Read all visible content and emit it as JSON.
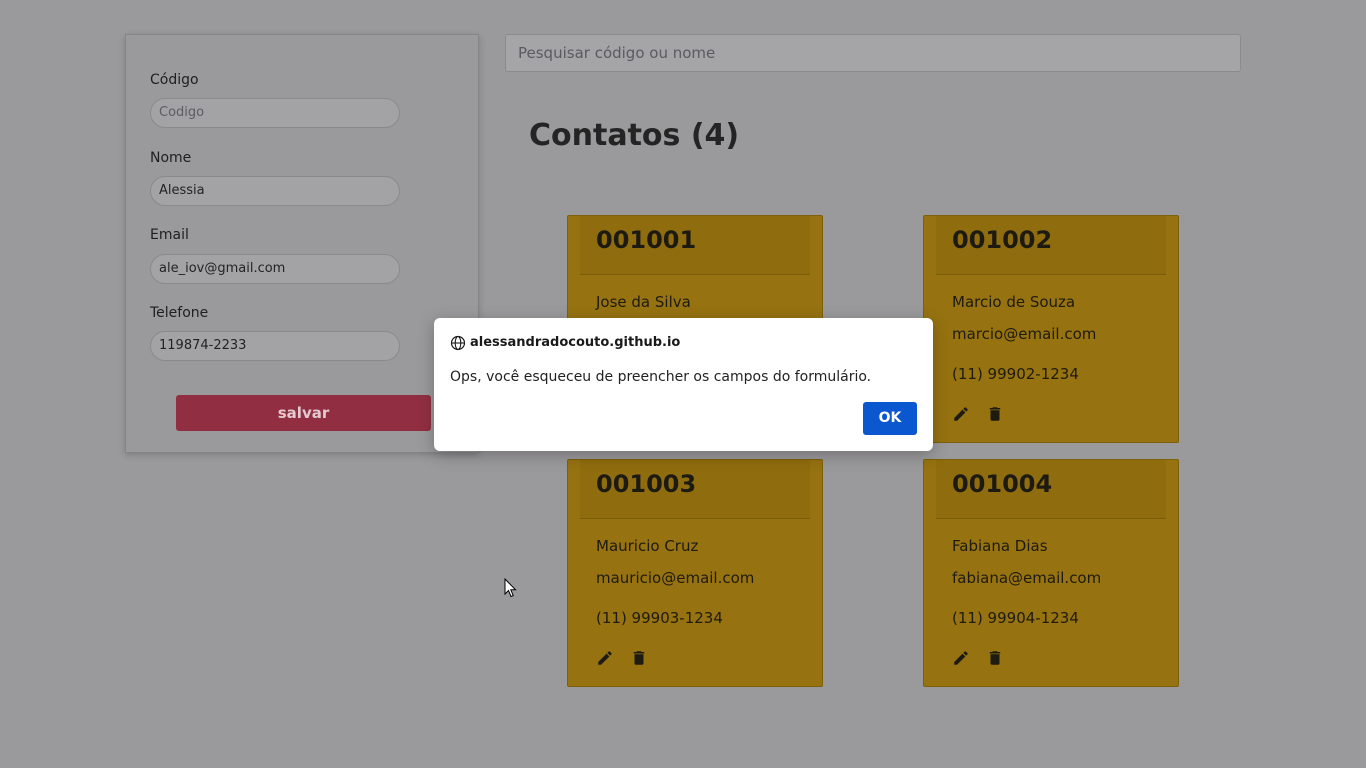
{
  "form": {
    "codigo_label": "Código",
    "codigo_placeholder": "Codigo",
    "nome_label": "Nome",
    "nome_value": "Alessia",
    "email_label": "Email",
    "email_value": "ale_iov@gmail.com",
    "telefone_label": "Telefone",
    "telefone_value": "119874-2233",
    "save_label": "salvar"
  },
  "search": {
    "placeholder": "Pesquisar código ou nome"
  },
  "contacts": {
    "title": "Contatos (4)",
    "cards": [
      {
        "code": "001001",
        "name": "Jose da Silva",
        "email": "",
        "phone": ""
      },
      {
        "code": "001002",
        "name": "Marcio de Souza",
        "email": "marcio@email.com",
        "phone": "(11) 99902-1234"
      },
      {
        "code": "001003",
        "name": "Mauricio Cruz",
        "email": "mauricio@email.com",
        "phone": "(11) 99903-1234"
      },
      {
        "code": "001004",
        "name": "Fabiana Dias",
        "email": "fabiana@email.com",
        "phone": "(11) 99904-1234"
      }
    ]
  },
  "dialog": {
    "origin": "alessandradocouto.github.io",
    "message": "Ops, você esqueceu de preencher os campos do formulário.",
    "ok_label": "OK"
  },
  "icons": {
    "edit": "pencil-icon",
    "delete": "trash-icon",
    "origin": "globe-icon"
  },
  "colors": {
    "card_bg": "#967210",
    "save_button": "#922e42",
    "ok_button": "#0b57d0"
  }
}
